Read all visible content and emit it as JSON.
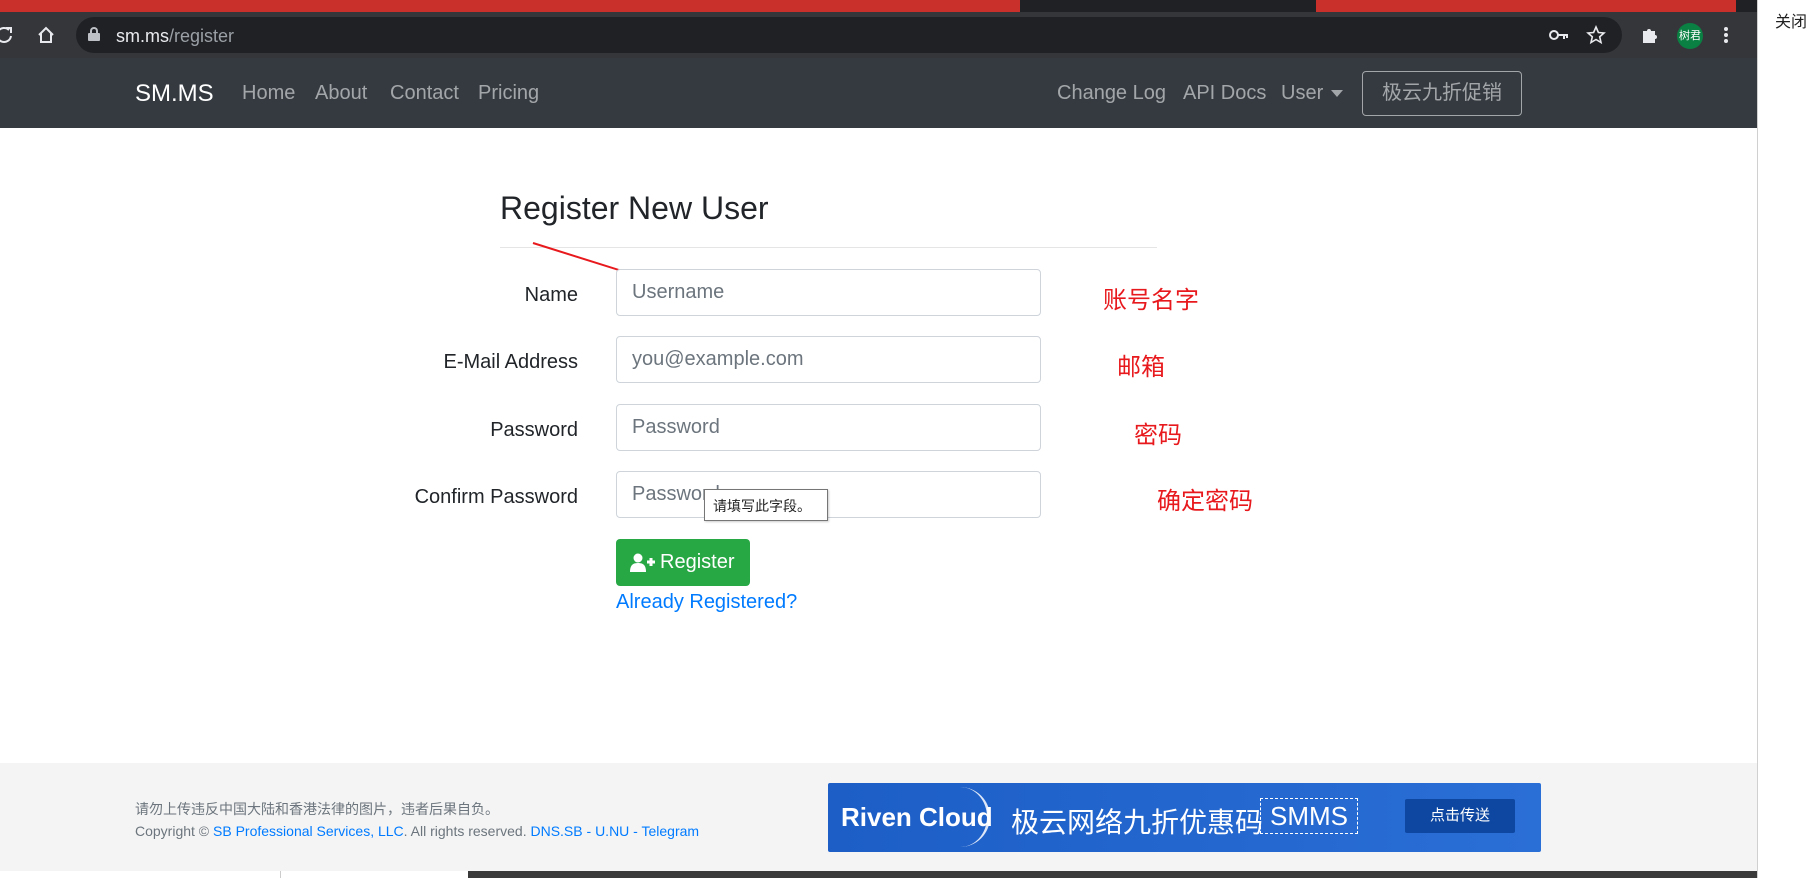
{
  "browser": {
    "url_host": "sm.ms",
    "url_path": "/register",
    "profile_name": "树君",
    "side_label": "关闭"
  },
  "navbar": {
    "brand": "SM.MS",
    "left_links": [
      "Home",
      "About",
      "Contact",
      "Pricing"
    ],
    "right_links": [
      "Change Log",
      "API Docs"
    ],
    "user_menu": "User",
    "promo_button": "极云九折促销"
  },
  "form": {
    "title": "Register New User",
    "fields": [
      {
        "label": "Name",
        "placeholder": "Username",
        "annotation": "账号名字"
      },
      {
        "label": "E-Mail Address",
        "placeholder": "you@example.com",
        "annotation": "邮箱"
      },
      {
        "label": "Password",
        "placeholder": "Password",
        "annotation": "密码"
      },
      {
        "label": "Confirm Password",
        "placeholder": "Password",
        "annotation": "确定密码"
      }
    ],
    "validation_tooltip": "请填写此字段。",
    "register_button": "Register",
    "already_registered": "Already Registered?"
  },
  "footer": {
    "notice": "请勿上传违反中国大陆和香港法律的图片，违者后果自负。",
    "copyright_prefix": "Copyright ©",
    "company_link": "SB Professional Services, LLC",
    "rights": ". All rights reserved.",
    "links": [
      "DNS.SB",
      "U.NU",
      "Telegram"
    ],
    "separator": " - "
  },
  "banner": {
    "brand": "Riven Cloud",
    "text": "极云网络九折优惠码",
    "code": "SMMS",
    "button": "点击传送"
  },
  "colors": {
    "navbar_bg": "#343a40",
    "success": "#28a745",
    "link": "#007bff",
    "annotation": "#e8191d",
    "banner": "#1c5ec6"
  }
}
